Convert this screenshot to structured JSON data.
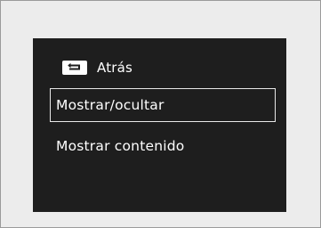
{
  "menu": {
    "back": {
      "icon": "back-arrow-icon",
      "label": "Atrás"
    },
    "items": [
      {
        "label": "Mostrar/ocultar",
        "selected": true
      },
      {
        "label": "Mostrar contenido",
        "selected": false
      }
    ]
  },
  "colors": {
    "frame_background": "#ececec",
    "screen_background": "#1e1e1e",
    "text": "#ffffff",
    "selection_border": "#e8e8e8"
  }
}
